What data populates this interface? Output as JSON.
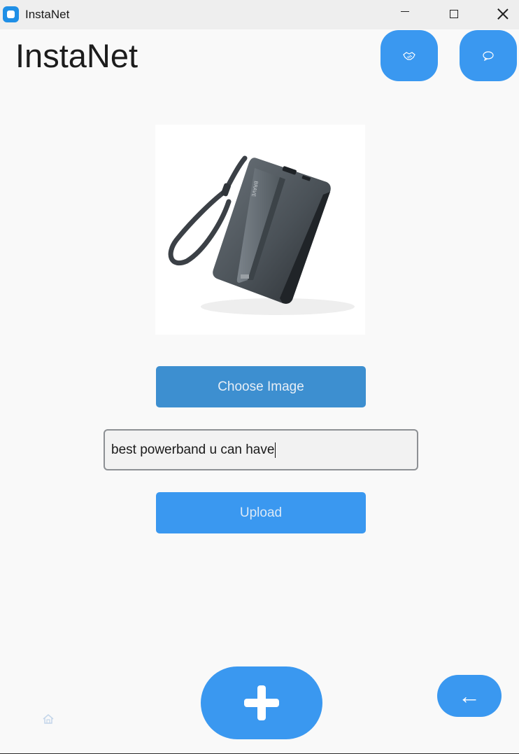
{
  "window": {
    "title": "InstaNet"
  },
  "header": {
    "app_name": "InstaNet",
    "button_1_icon": "handshake-icon",
    "button_2_icon": "chat-bubble-icon"
  },
  "product": {
    "image_icon": "power-bank-image"
  },
  "form": {
    "choose_image_label": "Choose Image",
    "caption_value": "best powerband u can have",
    "upload_label": "Upload"
  },
  "footer": {
    "home_icon": "home-icon",
    "add_icon": "plus-icon",
    "back_label": "←"
  },
  "colors": {
    "accent": "#3a98f0",
    "choose_button": "#3d8fd0",
    "background": "#f9f9f9"
  }
}
